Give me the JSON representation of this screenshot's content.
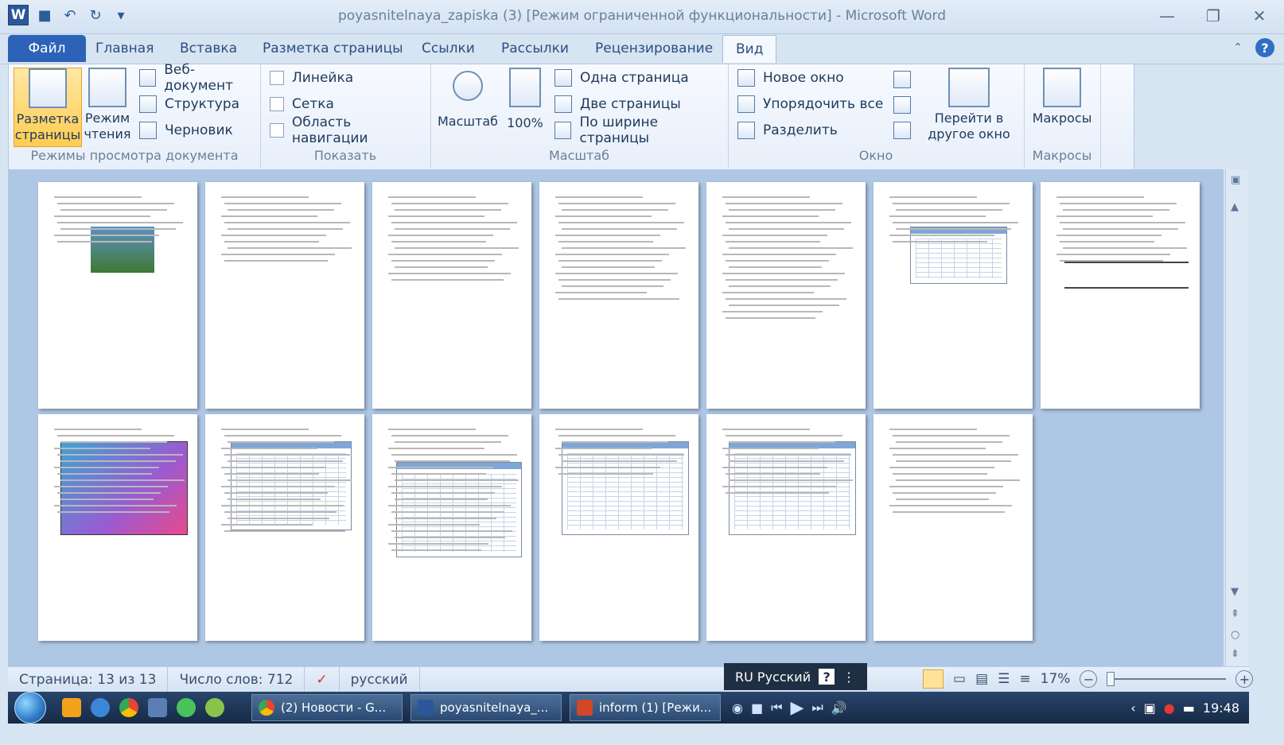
{
  "titlebar": {
    "title": "poyasnitelnaya_zapiska (3) [Режим ограниченной функциональности]  -  Microsoft Word"
  },
  "tabs": [
    "Файл",
    "Главная",
    "Вставка",
    "Разметка страницы",
    "Ссылки",
    "Рассылки",
    "Рецензирование",
    "Вид"
  ],
  "ribbon": {
    "views": {
      "print_layout": "Разметка страницы",
      "reading": "Режим чтения",
      "web": "Веб-документ",
      "outline": "Структура",
      "draft": "Черновик",
      "group": "Режимы просмотра документа"
    },
    "show": {
      "ruler": "Линейка",
      "grid": "Сетка",
      "nav": "Область навигации",
      "group": "Показать"
    },
    "zoom": {
      "zoom": "Масштаб",
      "percent": "100%",
      "one_page": "Одна страница",
      "two_pages": "Две страницы",
      "page_width": "По ширине страницы",
      "group": "Масштаб"
    },
    "window": {
      "new_window": "Новое окно",
      "arrange_all": "Упорядочить все",
      "split": "Разделить",
      "switch": "Перейти в другое окно",
      "group": "Окно"
    },
    "macros": {
      "macros": "Макросы",
      "group": "Макросы"
    }
  },
  "status": {
    "page": "Страница: 13 из 13",
    "words": "Число слов: 712",
    "language": "русский",
    "zoom": "17%"
  },
  "lang_pill": {
    "label": "RU Русский"
  },
  "taskbar": {
    "items": [
      "(2) Новости - G...",
      "poyasnitelnaya_...",
      "inform (1) [Режи..."
    ],
    "time": "19:48"
  },
  "colors": {
    "word_blue": "#2b579a",
    "file_tab": "#2c63b8",
    "doc_bg": "#aec7e5"
  }
}
